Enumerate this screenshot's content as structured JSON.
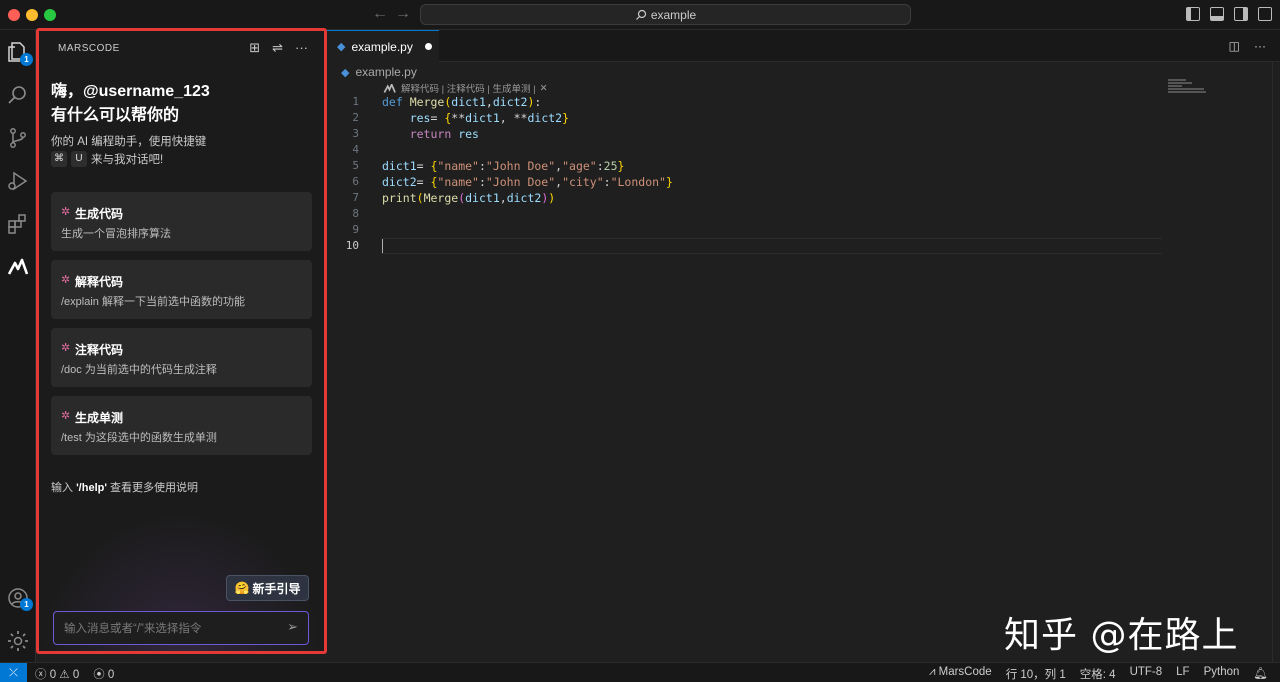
{
  "titlebar": {
    "search_text": "example",
    "back_icon": "arrow-left-icon",
    "forward_icon": "arrow-right-icon"
  },
  "activity": {
    "explorer_badge": "1",
    "accounts_badge": "1"
  },
  "sidebar": {
    "title": "MARSCODE",
    "greeting_line1": "嗨，@username_123",
    "greeting_line2": "有什么可以帮你的",
    "intro_line1": "你的 AI 编程助手，使用快捷键",
    "shortcut_key1": "⌘",
    "shortcut_key2": "U",
    "intro_line2_suffix": "来与我对话吧!",
    "cards": [
      {
        "title": "生成代码",
        "desc": "生成一个冒泡排序算法"
      },
      {
        "title": "解释代码",
        "desc": "/explain 解释一下当前选中函数的功能"
      },
      {
        "title": "注释代码",
        "desc": "/doc 为当前选中的代码生成注释"
      },
      {
        "title": "生成单测",
        "desc": "/test 为这段选中的函数生成单测"
      }
    ],
    "help_prefix": "输入",
    "help_cmd": "'/help'",
    "help_suffix": "查看更多使用说明",
    "guide_emoji": "🤗",
    "guide_label": "新手引导",
    "input_placeholder": "输入消息或者“/”来选择指令"
  },
  "editor": {
    "tab_label": "example.py",
    "breadcrumb_file": "example.py",
    "codelens": "解释代码 | 注释代码 | 生成单测 |",
    "line_numbers": [
      "1",
      "2",
      "3",
      "4",
      "5",
      "6",
      "7",
      "8",
      "9",
      "10"
    ]
  },
  "watermark": "知乎 @在路上",
  "statusbar": {
    "errors": "0",
    "warnings": "0",
    "ports": "0",
    "marscode": "MarsCode",
    "position": "行 10，列 1",
    "indent": "空格: 4",
    "encoding": "UTF-8",
    "eol": "LF",
    "language": "Python"
  },
  "colors": {
    "accent": "#0078d4",
    "highlight_border": "#e53935",
    "input_border": "#6b5bd6"
  }
}
